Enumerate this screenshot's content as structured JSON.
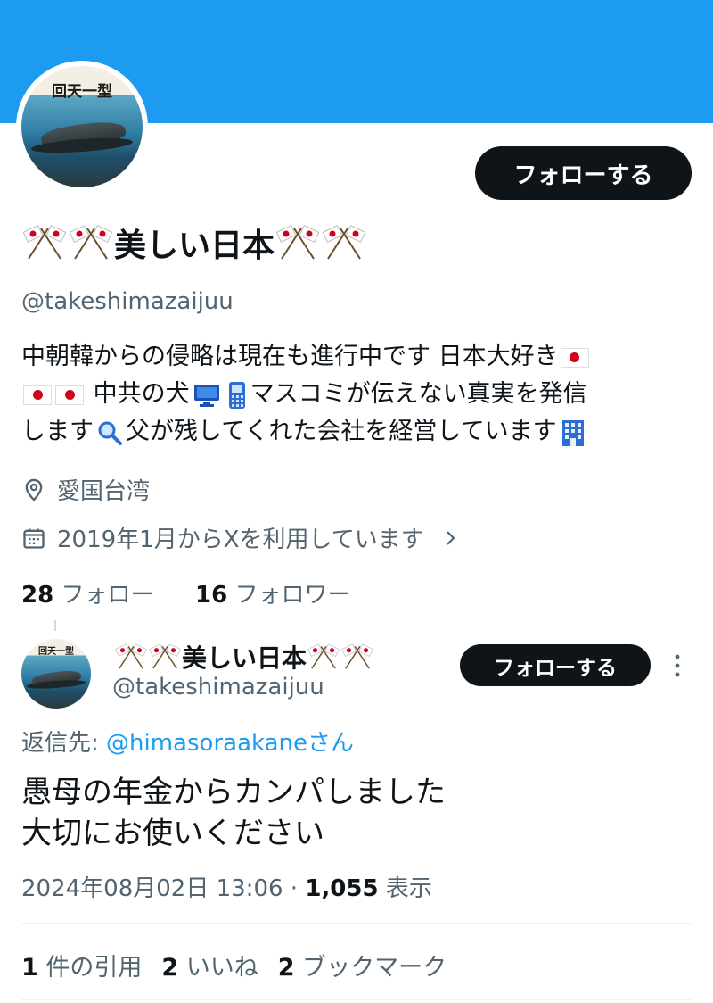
{
  "profile": {
    "avatar_text": "回天一型",
    "follow_button": "フォローする",
    "display_name": "美しい日本",
    "handle": "@takeshimazaijuu",
    "bio": {
      "line1_text": "中朝韓からの侵略は現在も進行中です 日本大好き",
      "line2_text": "中共の犬",
      "line2_text_b": "マスコミが伝えない真実を発信",
      "line3_text_a": "します",
      "line3_text_b": "父が残してくれた会社を経営しています"
    },
    "location": "愛国台湾",
    "joined": "2019年1月からXを利用しています",
    "following_count": "28",
    "following_label": "フォロー",
    "followers_count": "16",
    "followers_label": "フォロワー"
  },
  "tweet": {
    "author_name": "美しい日本",
    "author_handle": "@takeshimazaijuu",
    "follow_button": "フォローする",
    "reply_prefix": "返信先: ",
    "reply_to": "@himasoraakane",
    "reply_suffix": "さん",
    "text_line1": "愚母の年金からカンパしました",
    "text_line2": "大切にお使いください",
    "datetime": "2024年08月02日 13:06",
    "separator": " · ",
    "views_count": "1,055",
    "views_label": " 表示",
    "quotes_count": "1",
    "quotes_label": " 件の引用",
    "likes_count": "2",
    "likes_label": " いいね",
    "bookmarks_count": "2",
    "bookmarks_label": " ブックマーク"
  },
  "colors": {
    "banner": "#1d9bf0",
    "link": "#1d9bf0",
    "text": "#0f1419",
    "secondary": "#536471"
  },
  "icons": [
    "crossed-flags-icon",
    "japan-flag-icon",
    "computer-icon",
    "phone-icon",
    "magnifier-icon",
    "office-building-icon",
    "location-pin-icon",
    "calendar-icon",
    "chevron-right-icon",
    "more-vertical-icon"
  ]
}
